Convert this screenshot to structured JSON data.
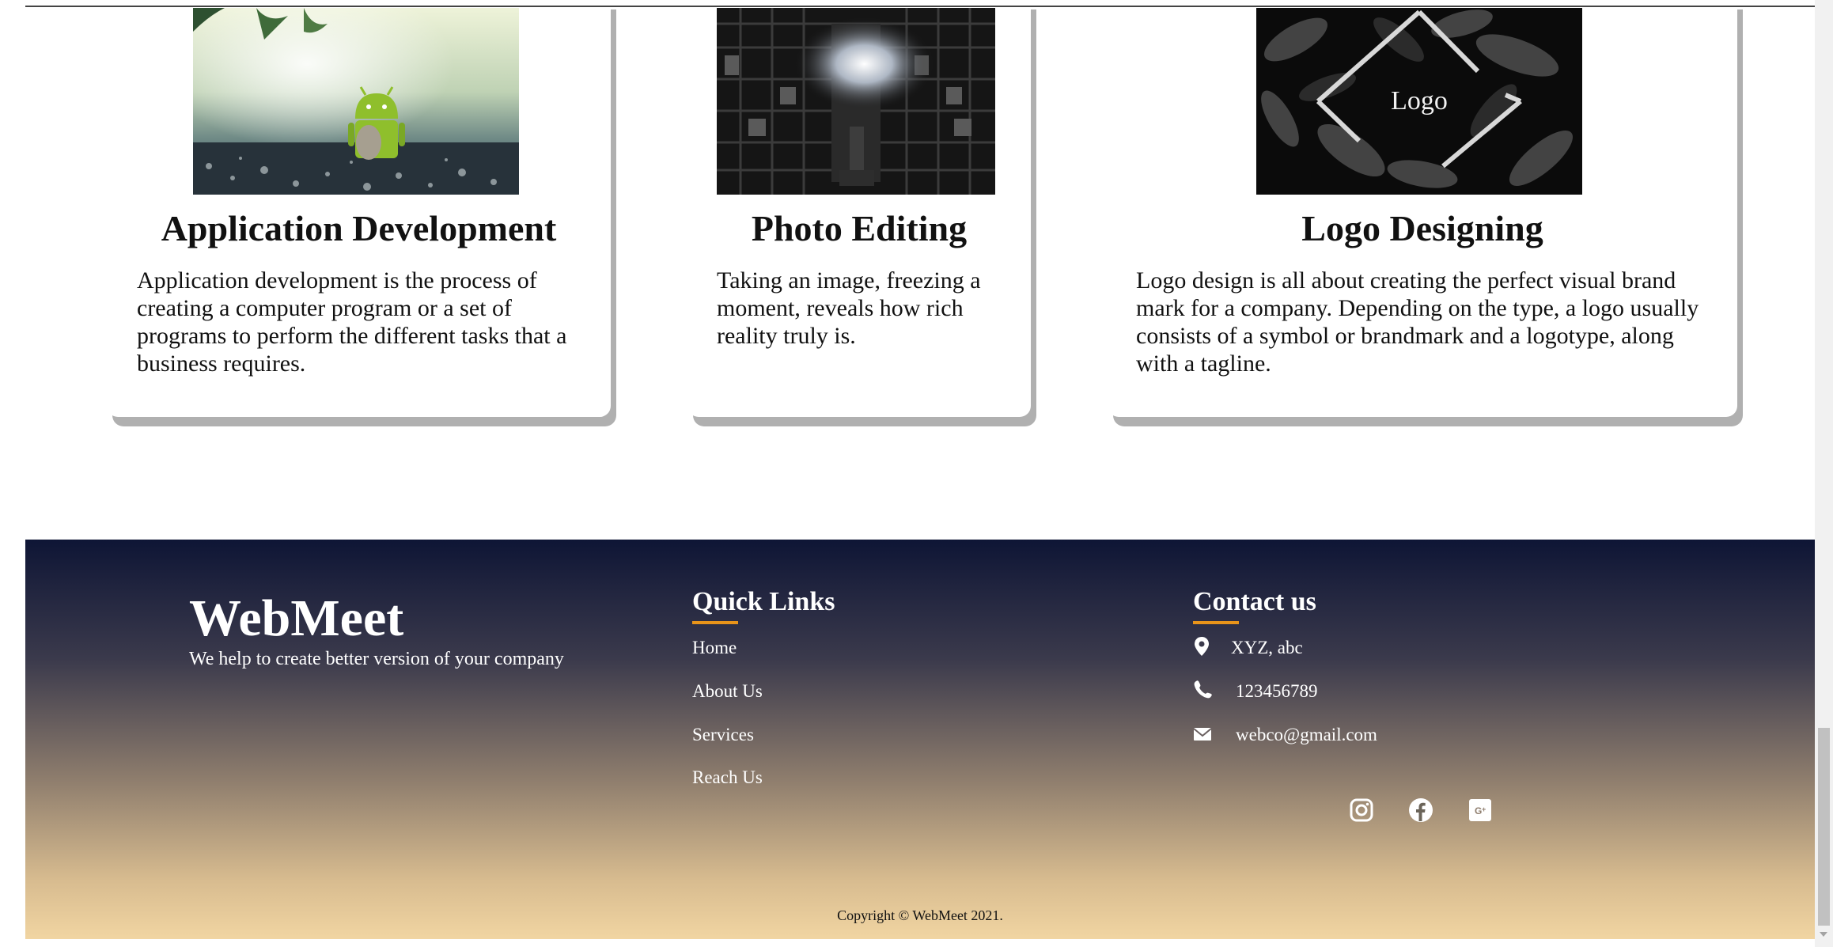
{
  "services": [
    {
      "title": "Application Development",
      "description": "Application development is the process of creating a computer program or a set of programs to perform the different tasks that a business requires.",
      "image": "android-robot-photo"
    },
    {
      "title": "Photo Editing",
      "description": "Taking an image, freezing a moment, reveals how rich reality truly is.",
      "image": "temple-carving-photo"
    },
    {
      "title": "Logo Designing",
      "description": "Logo design is all about creating the perfect visual brand mark for a company. Depending on the type, a logo usually consists of a symbol or brandmark and a logotype, along with a tagline.",
      "image": "leaves-logo-photo",
      "image_text": "Logo"
    }
  ],
  "footer": {
    "brand": "WebMeet",
    "tagline": "We help to create better version of your company",
    "quick_links_heading": "Quick Links",
    "quick_links": [
      "Home",
      "About Us",
      "Services",
      "Reach Us"
    ],
    "contact_heading": "Contact us",
    "contact": {
      "address": "XYZ, abc",
      "phone": "123456789",
      "email": "webco@gmail.com"
    },
    "social_icons": [
      "instagram-icon",
      "facebook-icon",
      "google-plus-icon"
    ],
    "copyright": "Copyright © WebMeet 2021.",
    "accent_color": "#e8941a"
  }
}
